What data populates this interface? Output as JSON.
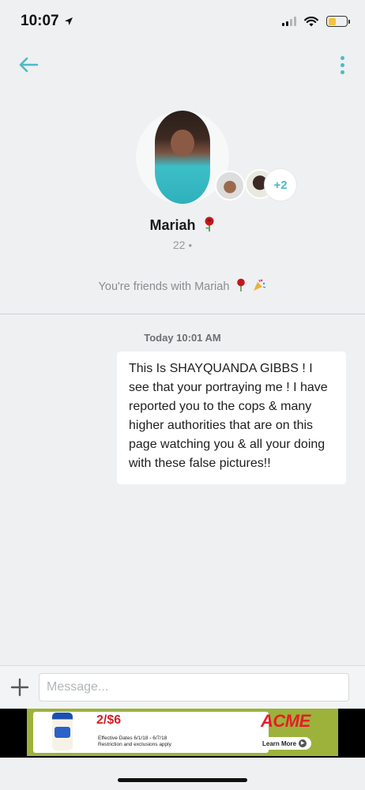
{
  "status_bar": {
    "time": "10:07",
    "battery_level": 0.45
  },
  "icons": {
    "back": "back-arrow-icon",
    "more": "more-vertical-icon",
    "add": "plus-icon",
    "location": "location-arrow-icon"
  },
  "profile": {
    "name": "Mariah",
    "age": "22",
    "extra_photos": "+2",
    "friends_text": "You're friends with Mariah"
  },
  "conversation": {
    "timestamp": "Today 10:01 AM",
    "messages": [
      {
        "text": "This Is SHAYQUANDA GIBBS ! I see that your portraying me ! I have reported you to the cops & many higher authorities that are on this page watching you & all your doing with these false pictures!!"
      }
    ]
  },
  "composer": {
    "placeholder": "Message..."
  },
  "ad": {
    "price": "2/$6",
    "fine_print_1": "Effective Dates 6/1/18 - 6/7/18",
    "fine_print_2": "Restriction and exclusions apply",
    "brand": "ACME",
    "cta": "Learn More"
  },
  "colors": {
    "accent": "#4fb9c4",
    "background": "#eef0f1",
    "ad_green": "#9cb23b",
    "ad_red": "#e41e26"
  }
}
